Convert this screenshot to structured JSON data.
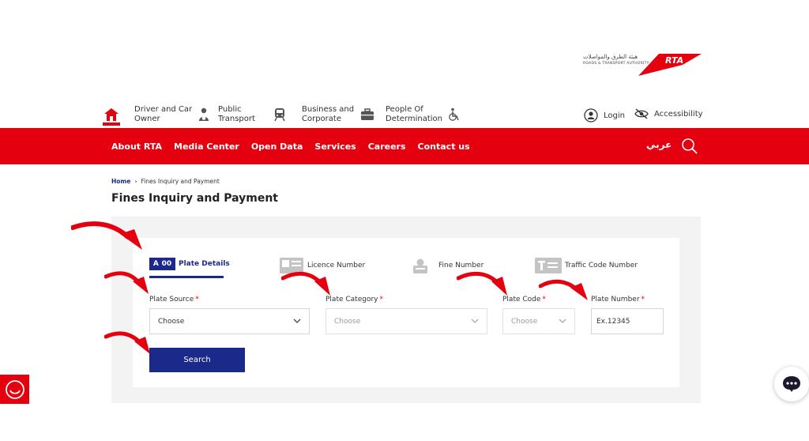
{
  "logo": {
    "name": "RTA",
    "arabic_line": "هيئة الطرق والمواصلات",
    "english_line": "ROADS & TRANSPORT AUTHORITY"
  },
  "top_nav": {
    "items": [
      {
        "label_line1": "Driver and Car",
        "label_line2": "Owner",
        "icon": "driver-icon"
      },
      {
        "label_line1": "Public",
        "label_line2": "Transport",
        "icon": "train-icon"
      },
      {
        "label_line1": "Business and",
        "label_line2": "Corporate",
        "icon": "briefcase-icon"
      },
      {
        "label_line1": "People Of",
        "label_line2": "Determination",
        "icon": "wheelchair-icon"
      }
    ],
    "login": "Login",
    "accessibility": "Accessibility"
  },
  "main_menu": {
    "items": [
      "About RTA",
      "Media Center",
      "Open Data",
      "Services",
      "Careers",
      "Contact us"
    ],
    "language": "عربي"
  },
  "breadcrumb": {
    "home": "Home",
    "current": "Fines Inquiry and Payment"
  },
  "page": {
    "title": "Fines Inquiry and Payment"
  },
  "tabs": [
    {
      "label": "Plate Details",
      "icon_text": [
        "A",
        "00"
      ],
      "active": true
    },
    {
      "label": "Licence Number",
      "icon": "id-card-icon",
      "active": false
    },
    {
      "label": "Fine Number",
      "icon": "fine-icon",
      "active": false
    },
    {
      "label": "Traffic Code Number",
      "icon": "traffic-code-icon",
      "active": false
    }
  ],
  "form": {
    "plate_source": {
      "label": "Plate Source",
      "required": "*",
      "value": "Choose"
    },
    "plate_category": {
      "label": "Plate Category",
      "required": "*",
      "value": "Choose"
    },
    "plate_code": {
      "label": "Plate Code",
      "required": "*",
      "value": "Choose"
    },
    "plate_number": {
      "label": "Plate Number",
      "required": "*",
      "placeholder": "Ex.12345"
    },
    "search_button": "Search"
  },
  "colors": {
    "brand_red": "#e4000f",
    "brand_blue": "#1b2a8a"
  }
}
